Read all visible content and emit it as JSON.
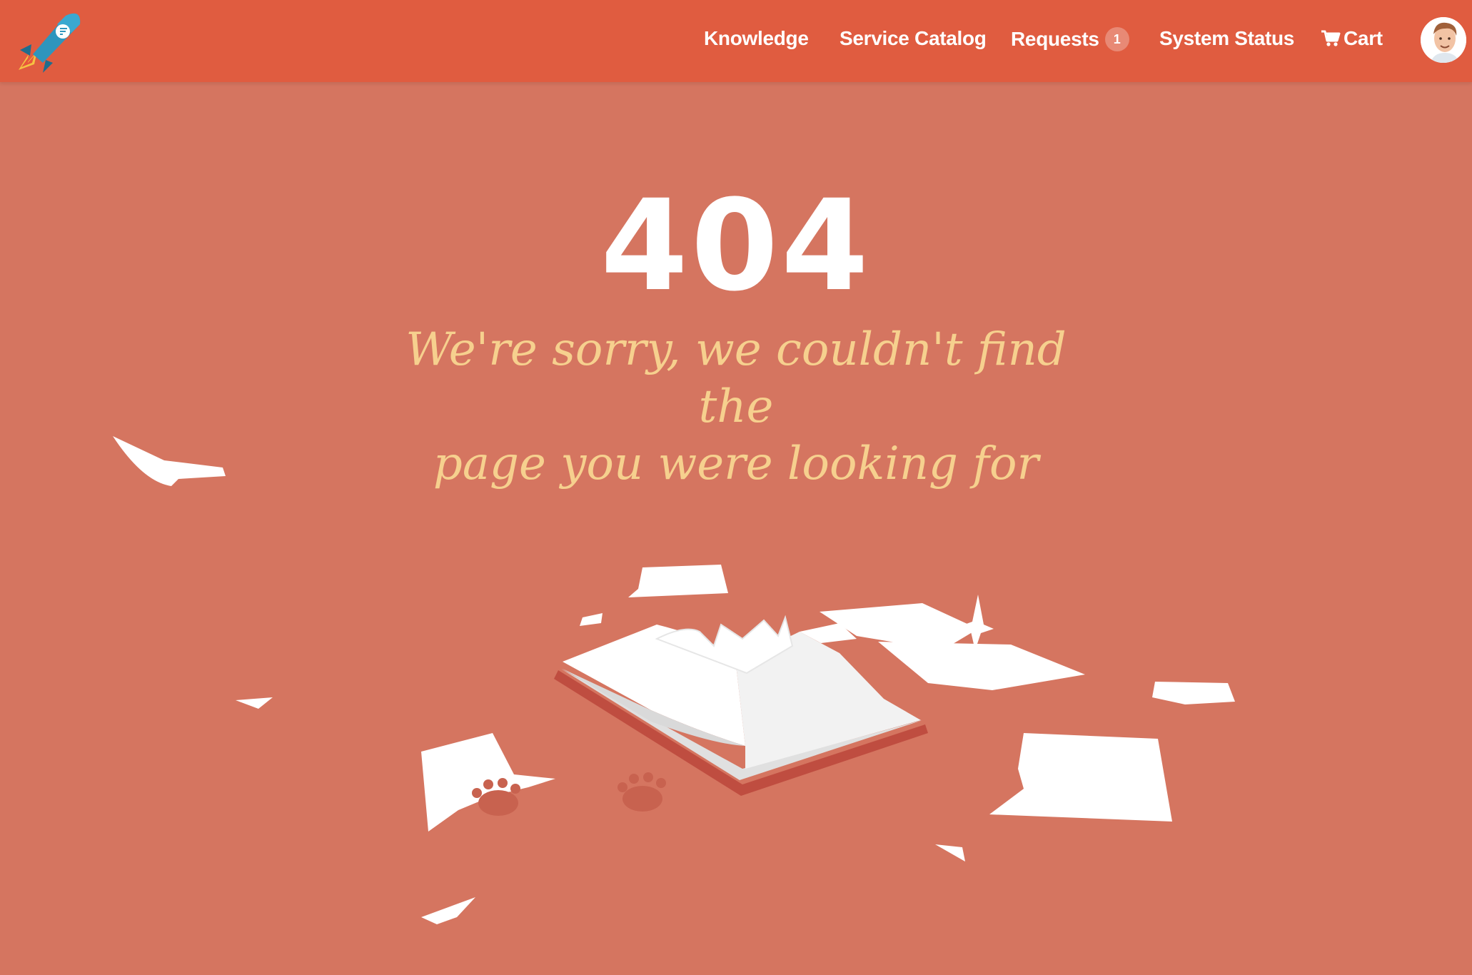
{
  "nav": {
    "items": [
      {
        "label": "Knowledge"
      },
      {
        "label": "Service Catalog"
      },
      {
        "label": "Requests",
        "badge": "1"
      },
      {
        "label": "System Status"
      },
      {
        "label": "Cart",
        "icon": "shopping-cart-icon"
      }
    ],
    "logo_icon": "rocket-logo-icon",
    "avatar_icon": "user-avatar-icon"
  },
  "error": {
    "code": "404",
    "message_line1": "We're sorry, we couldn't find the",
    "message_line2": "page you were looking for"
  },
  "illustration": {
    "icon": "torn-book-illustration"
  },
  "colors": {
    "header": "#e05c40",
    "background": "#d57560",
    "message": "#f6d08e",
    "code": "#ffffff"
  }
}
